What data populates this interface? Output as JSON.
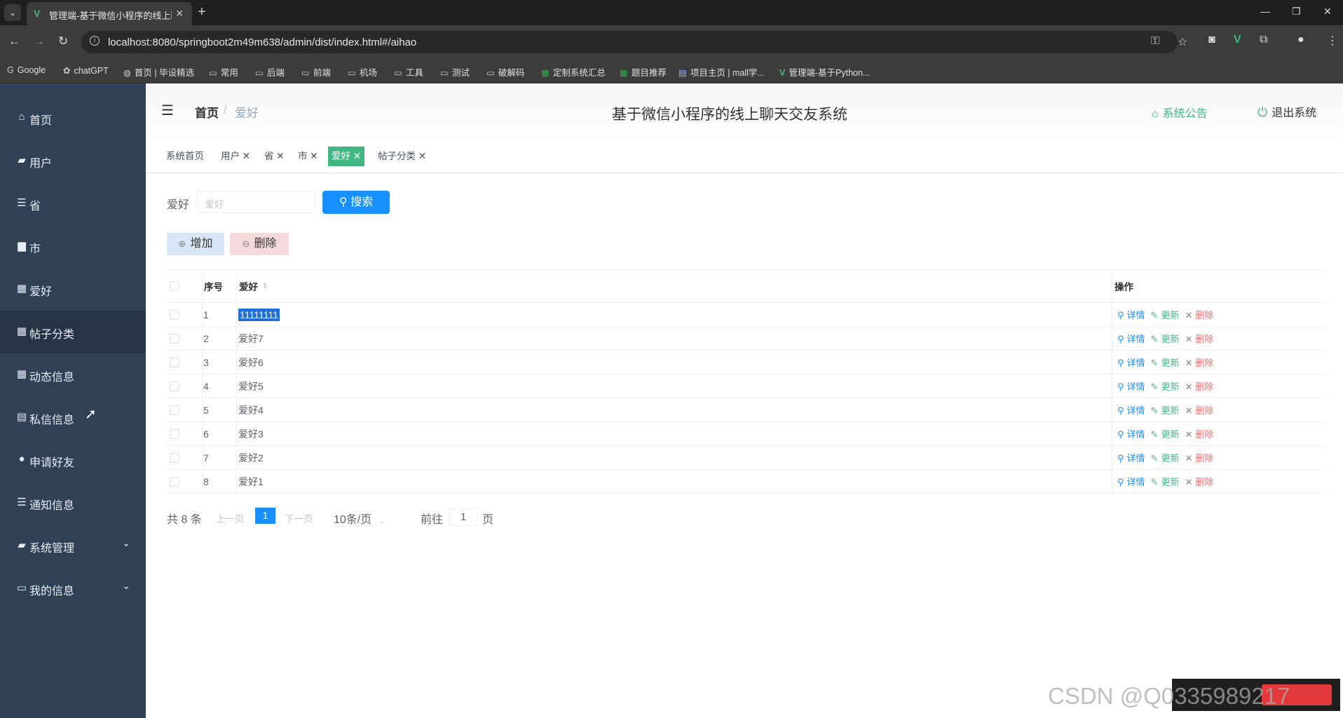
{
  "browser": {
    "tab_title": "管理端-基于微信小程序的线上聊天交友系统",
    "tab_icon": "vue-logo-icon",
    "url": "localhost:8080/springboot2m49m638/admin/dist/index.html#/aihao",
    "bookmarks": [
      {
        "label": "Google",
        "icon": "google-icon"
      },
      {
        "label": "chatGPT",
        "icon": "chatgpt-icon"
      },
      {
        "label": "首页 | 毕设精选",
        "icon": "site-icon"
      },
      {
        "label": "常用",
        "icon": "folder-icon"
      },
      {
        "label": "后端",
        "icon": "folder-icon"
      },
      {
        "label": "前端",
        "icon": "folder-icon"
      },
      {
        "label": "机场",
        "icon": "folder-icon"
      },
      {
        "label": "工具",
        "icon": "folder-icon"
      },
      {
        "label": "测试",
        "icon": "folder-icon"
      },
      {
        "label": "破解码",
        "icon": "folder-icon"
      },
      {
        "label": "定制系统汇总",
        "icon": "sheet-icon"
      },
      {
        "label": "题目推荐",
        "icon": "sheet-icon"
      },
      {
        "label": "项目主页 | mall学...",
        "icon": "site-icon"
      },
      {
        "label": "管理端-基于Python...",
        "icon": "vue-logo-icon"
      }
    ]
  },
  "sidebar": {
    "items": [
      {
        "label": "首页",
        "icon": "home-icon"
      },
      {
        "label": "用户",
        "icon": "monitor-icon"
      },
      {
        "label": "省",
        "icon": "sliders-icon"
      },
      {
        "label": "市",
        "icon": "chat-icon"
      },
      {
        "label": "爱好",
        "icon": "grid-icon"
      },
      {
        "label": "帖子分类",
        "icon": "grid-icon"
      },
      {
        "label": "动态信息",
        "icon": "grid-icon"
      },
      {
        "label": "私信信息",
        "icon": "clipboard-icon"
      },
      {
        "label": "申请好友",
        "icon": "user-icon"
      },
      {
        "label": "通知信息",
        "icon": "list-icon"
      },
      {
        "label": "系统管理",
        "icon": "monitor-icon"
      },
      {
        "label": "我的信息",
        "icon": "card-icon"
      }
    ]
  },
  "header": {
    "breadcrumb_home": "首页",
    "breadcrumb_sep": "/",
    "breadcrumb_current": "爱好",
    "title": "基于微信小程序的线上聊天交友系统",
    "notice_label": "系统公告",
    "logout_label": "退出系统"
  },
  "tags": [
    {
      "label": "系统首页",
      "closable": false
    },
    {
      "label": "用户",
      "closable": true
    },
    {
      "label": "省",
      "closable": true
    },
    {
      "label": "市",
      "closable": true
    },
    {
      "label": "爱好",
      "closable": true
    },
    {
      "label": "帖子分类",
      "closable": true
    }
  ],
  "search": {
    "label": "爱好",
    "placeholder": "爱好",
    "button_label": "搜索"
  },
  "actions": {
    "add_label": "增加",
    "delete_label": "删除"
  },
  "table": {
    "headers": {
      "index": "序号",
      "hobby": "爱好",
      "ops": "操作"
    },
    "rows": [
      {
        "index": "1",
        "hobby": "11111111"
      },
      {
        "index": "2",
        "hobby": "爱好7"
      },
      {
        "index": "3",
        "hobby": "爱好6"
      },
      {
        "index": "4",
        "hobby": "爱好5"
      },
      {
        "index": "5",
        "hobby": "爱好4"
      },
      {
        "index": "6",
        "hobby": "爱好3"
      },
      {
        "index": "7",
        "hobby": "爱好2"
      },
      {
        "index": "8",
        "hobby": "爱好1"
      }
    ],
    "op_detail": "详情",
    "op_update": "更新",
    "op_delete": "删除"
  },
  "pagination": {
    "total": "共 8 条",
    "prev": "上一页",
    "current": "1",
    "next": "下一页",
    "page_size": "10条/页",
    "goto_label": "前往",
    "goto_value": "1",
    "page_suffix": "页"
  },
  "watermark": "CSDN @Q0335989217"
}
